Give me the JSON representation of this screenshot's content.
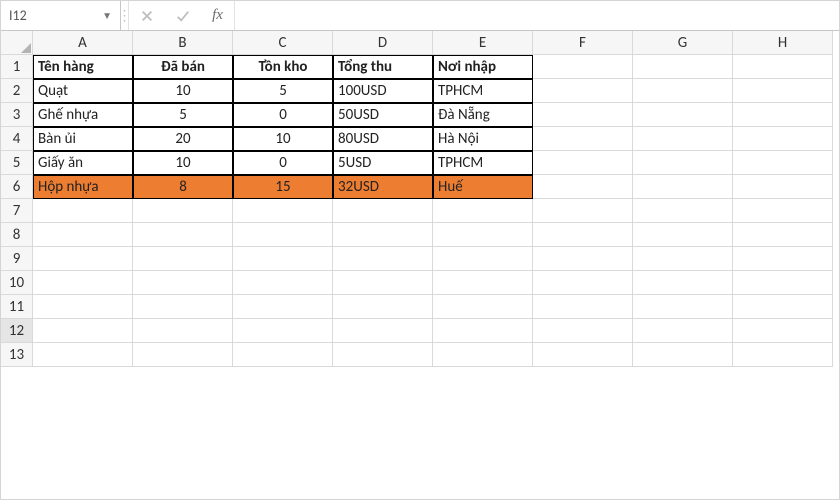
{
  "namebox": {
    "value": "I12"
  },
  "fx_label": "fx",
  "columns": [
    "A",
    "B",
    "C",
    "D",
    "E",
    "F",
    "G",
    "H"
  ],
  "rows": [
    "1",
    "2",
    "3",
    "4",
    "5",
    "6",
    "7",
    "8",
    "9",
    "10",
    "11",
    "12",
    "13"
  ],
  "active_row": "12",
  "headers": {
    "A": "Tên hàng",
    "B": "Đã bán",
    "C": "Tồn kho",
    "D": "Tổng thu",
    "E": "Nơi nhập"
  },
  "data": [
    {
      "A": "Quạt",
      "B": "10",
      "C": "5",
      "D": "100USD",
      "E": "TPHCM"
    },
    {
      "A": "Ghế nhựa",
      "B": "5",
      "C": "0",
      "D": "50USD",
      "E": "Đà Nẵng"
    },
    {
      "A": "Bàn ủi",
      "B": "20",
      "C": "10",
      "D": "80USD",
      "E": "Hà Nội"
    },
    {
      "A": "Giấy ăn",
      "B": "10",
      "C": "0",
      "D": "5USD",
      "E": "TPHCM"
    },
    {
      "A": "Hộp nhựa",
      "B": "8",
      "C": "15",
      "D": "32USD",
      "E": "Huế"
    }
  ],
  "highlight_row_index": 4,
  "colors": {
    "highlight": "#ed7d31"
  }
}
